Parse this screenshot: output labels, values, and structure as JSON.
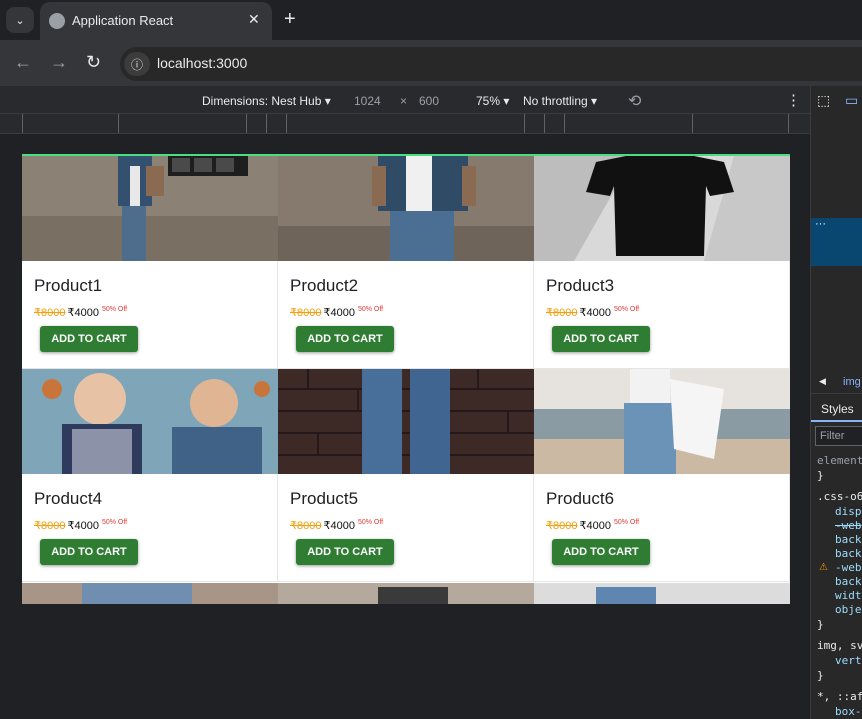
{
  "browser": {
    "tab_title": "Application React",
    "tab_close": "✕",
    "new_tab": "+",
    "url": "localhost:3000",
    "menu_icon": "⌄"
  },
  "devbar": {
    "dimensions_label": "Dimensions: Nest Hub ▾",
    "width": "1024",
    "times": "×",
    "height": "600",
    "zoom": "75% ▾",
    "throttling": "No throttling ▾",
    "more": "⋮"
  },
  "products": [
    {
      "name": "Product1",
      "old_price": "₹8000",
      "price": "₹4000",
      "discount": "50% Off",
      "button": "ADD TO CART"
    },
    {
      "name": "Product2",
      "old_price": "₹8000",
      "price": "₹4000",
      "discount": "50% Off",
      "button": "ADD TO CART"
    },
    {
      "name": "Product3",
      "old_price": "₹8000",
      "price": "₹4000",
      "discount": "50% Off",
      "button": "ADD TO CART"
    },
    {
      "name": "Product4",
      "old_price": "₹8000",
      "price": "₹4000",
      "discount": "50% Off",
      "button": "ADD TO CART"
    },
    {
      "name": "Product5",
      "old_price": "₹8000",
      "price": "₹4000",
      "discount": "50% Off",
      "button": "ADD TO CART"
    },
    {
      "name": "Product6",
      "old_price": "₹8000",
      "price": "₹4000",
      "discount": "50% Off",
      "button": "ADD TO CART"
    }
  ],
  "devtools": {
    "img_tab": "img",
    "styles_tab": "Styles",
    "filter_placeholder": "Filter",
    "lines": [
      "element",
      "}",
      ".css-o6",
      "disp",
      "-web",
      "back",
      "back",
      "-web",
      "back",
      "width",
      "objec",
      "}",
      "img, sv",
      "verti",
      "}",
      "*, ::af",
      "box-"
    ]
  },
  "colors": {
    "accent_green": "#2e7d32",
    "old_price": "#f59e0b",
    "discount": "#e53935",
    "devtools_selection": "#094771"
  }
}
